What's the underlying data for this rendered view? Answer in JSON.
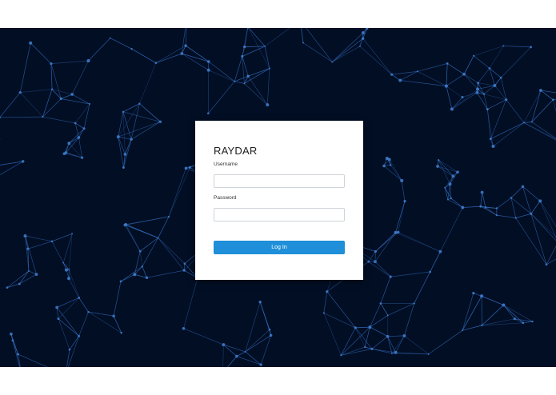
{
  "login": {
    "brand": "RAYDAR",
    "username_label": "Username",
    "username_value": "",
    "password_label": "Password",
    "password_value": "",
    "submit_label": "Log In"
  },
  "colors": {
    "background": "#020e24",
    "network_line": "#2f67b3",
    "network_node": "#3f7fd0",
    "card": "#ffffff",
    "button": "#1e8fd8",
    "button_text": "#ffffff"
  }
}
